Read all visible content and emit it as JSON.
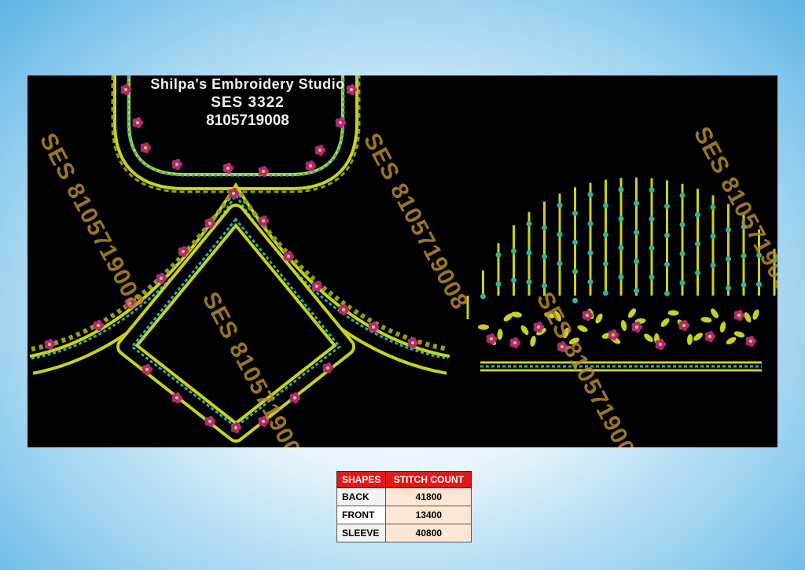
{
  "header": {
    "studio": "Shilpa's Embroidery Studio",
    "code": "SES  3322",
    "phone": "8105719008"
  },
  "watermark": "SES 8105719008",
  "table": {
    "headers": [
      "SHAPES",
      "STITCH COUNT"
    ],
    "rows": [
      {
        "shape": "BACK",
        "count": "41800"
      },
      {
        "shape": "FRONT",
        "count": "13400"
      },
      {
        "shape": "SLEEVE",
        "count": "40800"
      }
    ]
  },
  "colors": {
    "background": "#000000",
    "thread_yellow": "#c8d21e",
    "thread_teal": "#2bb3a3",
    "flower_magenta": "#b02a78",
    "watermark": "#b58a2a",
    "table_header": "#e01818"
  }
}
